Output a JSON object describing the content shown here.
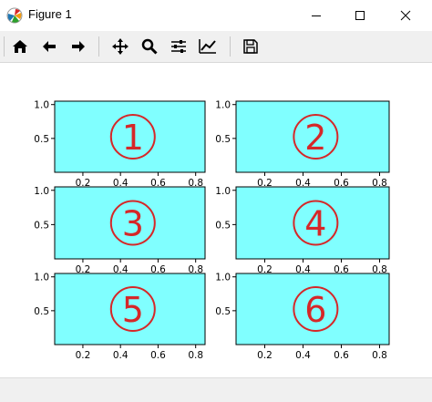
{
  "window": {
    "title": "Figure 1",
    "buttons": [
      "minimize",
      "maximize",
      "close"
    ]
  },
  "toolbar": {
    "tools": [
      {
        "name": "home",
        "icon": "home-icon"
      },
      {
        "name": "back",
        "icon": "arrow-left-icon"
      },
      {
        "name": "forward",
        "icon": "arrow-right-icon"
      },
      {
        "name": "pan",
        "icon": "move-icon"
      },
      {
        "name": "zoom",
        "icon": "zoom-icon"
      },
      {
        "name": "subplots",
        "icon": "sliders-icon"
      },
      {
        "name": "customize",
        "icon": "line-chart-icon"
      },
      {
        "name": "save",
        "icon": "save-icon"
      }
    ]
  },
  "colors": {
    "axes_face": "#80ffff",
    "label_color": "#d62728"
  },
  "chart_data": [
    {
      "type": "table",
      "label": "①",
      "xlim": [
        0.05,
        0.85
      ],
      "ylim": [
        0.0,
        1.05
      ],
      "xticks": [
        "0.2",
        "0.4",
        "0.6",
        "0.8"
      ],
      "yticks": [
        "0.5",
        "1.0"
      ]
    },
    {
      "type": "table",
      "label": "②",
      "xlim": [
        0.05,
        0.85
      ],
      "ylim": [
        0.0,
        1.05
      ],
      "xticks": [
        "0.2",
        "0.4",
        "0.6",
        "0.8"
      ],
      "yticks": [
        "0.5",
        "1.0"
      ]
    },
    {
      "type": "table",
      "label": "③",
      "xlim": [
        0.05,
        0.85
      ],
      "ylim": [
        0.0,
        1.05
      ],
      "xticks": [
        "0.2",
        "0.4",
        "0.6",
        "0.8"
      ],
      "yticks": [
        "0.5",
        "1.0"
      ]
    },
    {
      "type": "table",
      "label": "④",
      "xlim": [
        0.05,
        0.85
      ],
      "ylim": [
        0.0,
        1.05
      ],
      "xticks": [
        "0.2",
        "0.4",
        "0.6",
        "0.8"
      ],
      "yticks": [
        "0.5",
        "1.0"
      ]
    },
    {
      "type": "table",
      "label": "⑤",
      "xlim": [
        0.05,
        0.85
      ],
      "ylim": [
        0.0,
        1.05
      ],
      "xticks": [
        "0.2",
        "0.4",
        "0.6",
        "0.8"
      ],
      "yticks": [
        "0.5",
        "1.0"
      ]
    },
    {
      "type": "table",
      "label": "⑥",
      "xlim": [
        0.05,
        0.85
      ],
      "ylim": [
        0.0,
        1.05
      ],
      "xticks": [
        "0.2",
        "0.4",
        "0.6",
        "0.8"
      ],
      "yticks": [
        "0.5",
        "1.0"
      ]
    }
  ]
}
